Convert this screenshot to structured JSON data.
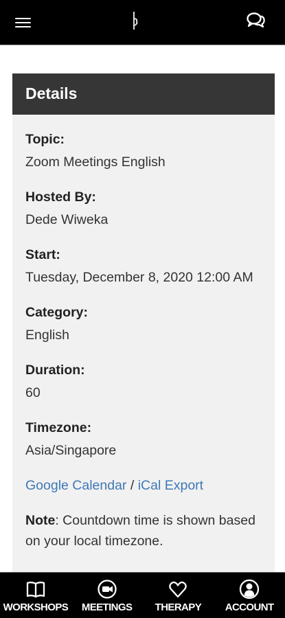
{
  "header": {
    "menu_icon": "hamburger-icon",
    "logo_icon": "brand-logo",
    "chat_icon": "chat-bubbles-icon"
  },
  "details": {
    "title": "Details",
    "fields": [
      {
        "label": "Topic:",
        "value": "Zoom Meetings English"
      },
      {
        "label": "Hosted By:",
        "value": "Dede Wiweka"
      },
      {
        "label": "Start:",
        "value": "Tuesday, December 8, 2020 12:00 AM"
      },
      {
        "label": "Category:",
        "value": "English"
      },
      {
        "label": "Duration:",
        "value": "60"
      },
      {
        "label": "Timezone:",
        "value": "Asia/Singapore"
      }
    ],
    "links": {
      "google_calendar": "Google Calendar",
      "separator": " / ",
      "ical_export": "iCal Export"
    },
    "note": {
      "label": "Note",
      "text": ": Countdown time is shown based on your local timezone."
    }
  },
  "bottom_nav": [
    {
      "label": "WORKSHOPS",
      "icon": "book-icon"
    },
    {
      "label": "MEETINGS",
      "icon": "video-camera-icon"
    },
    {
      "label": "THERAPY",
      "icon": "heart-icon"
    },
    {
      "label": "ACCOUNT",
      "icon": "user-icon"
    }
  ],
  "colors": {
    "bar": "#000000",
    "card_header": "#363636",
    "card_bg": "#f1f1f1",
    "link": "#3f78b5"
  }
}
